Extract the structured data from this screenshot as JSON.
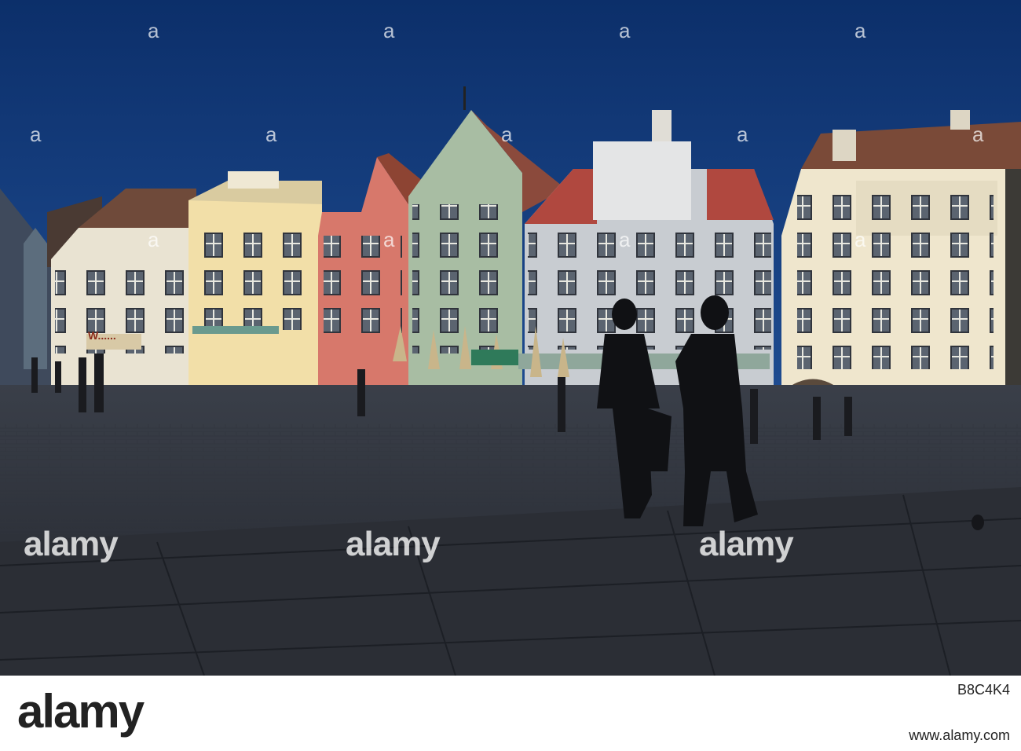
{
  "photo": {
    "shop_sign": "W......",
    "sky_color": "#123a78",
    "ground_color": "#2a2e37",
    "building_colors": [
      "#e9e3d2",
      "#f2dfa8",
      "#d7786b",
      "#a8bda3",
      "#c8ccd1",
      "#efe6cd"
    ],
    "roof_colors": [
      "#7a4a38",
      "#9b4a3c",
      "#b0483f"
    ]
  },
  "watermark": {
    "brand": "alamy",
    "icon": "alamy-a-icon"
  },
  "footer": {
    "logo": "alamy",
    "image_id": "B8C4K4",
    "url": "www.alamy.com"
  }
}
